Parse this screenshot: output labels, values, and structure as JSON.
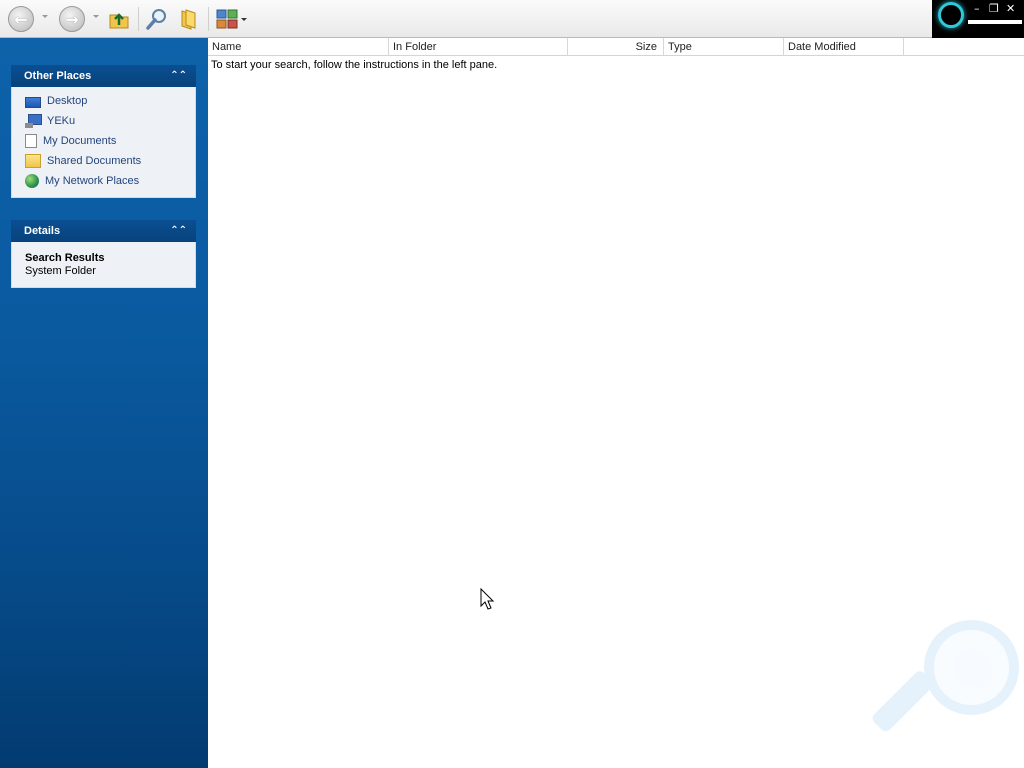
{
  "toolbar": {
    "back_icon": "back-arrow-icon",
    "forward_icon": "forward-arrow-icon",
    "up_icon": "up-folder-icon",
    "search_icon": "search-icon",
    "folders_icon": "folders-icon",
    "views_icon": "views-icon"
  },
  "window": {
    "minimize": "–",
    "restore": "❐",
    "close": "✕"
  },
  "left": {
    "other_places": {
      "title": "Other Places",
      "items": [
        {
          "label": "Desktop",
          "icon": "desktop-icon"
        },
        {
          "label": "YEKu",
          "icon": "computer-icon"
        },
        {
          "label": "My Documents",
          "icon": "documents-icon"
        },
        {
          "label": "Shared Documents",
          "icon": "folder-icon"
        },
        {
          "label": "My Network Places",
          "icon": "network-icon"
        }
      ]
    },
    "details": {
      "title": "Details",
      "name": "Search Results",
      "type": "System Folder"
    }
  },
  "main": {
    "columns": [
      "Name",
      "In Folder",
      "Size",
      "Type",
      "Date Modified"
    ],
    "hint": "To start your search, follow the instructions in the left pane."
  },
  "colors": {
    "pane_blue": "#0a5aa0",
    "link_blue": "#23457e",
    "accent_cyan": "#2fc9d9"
  }
}
